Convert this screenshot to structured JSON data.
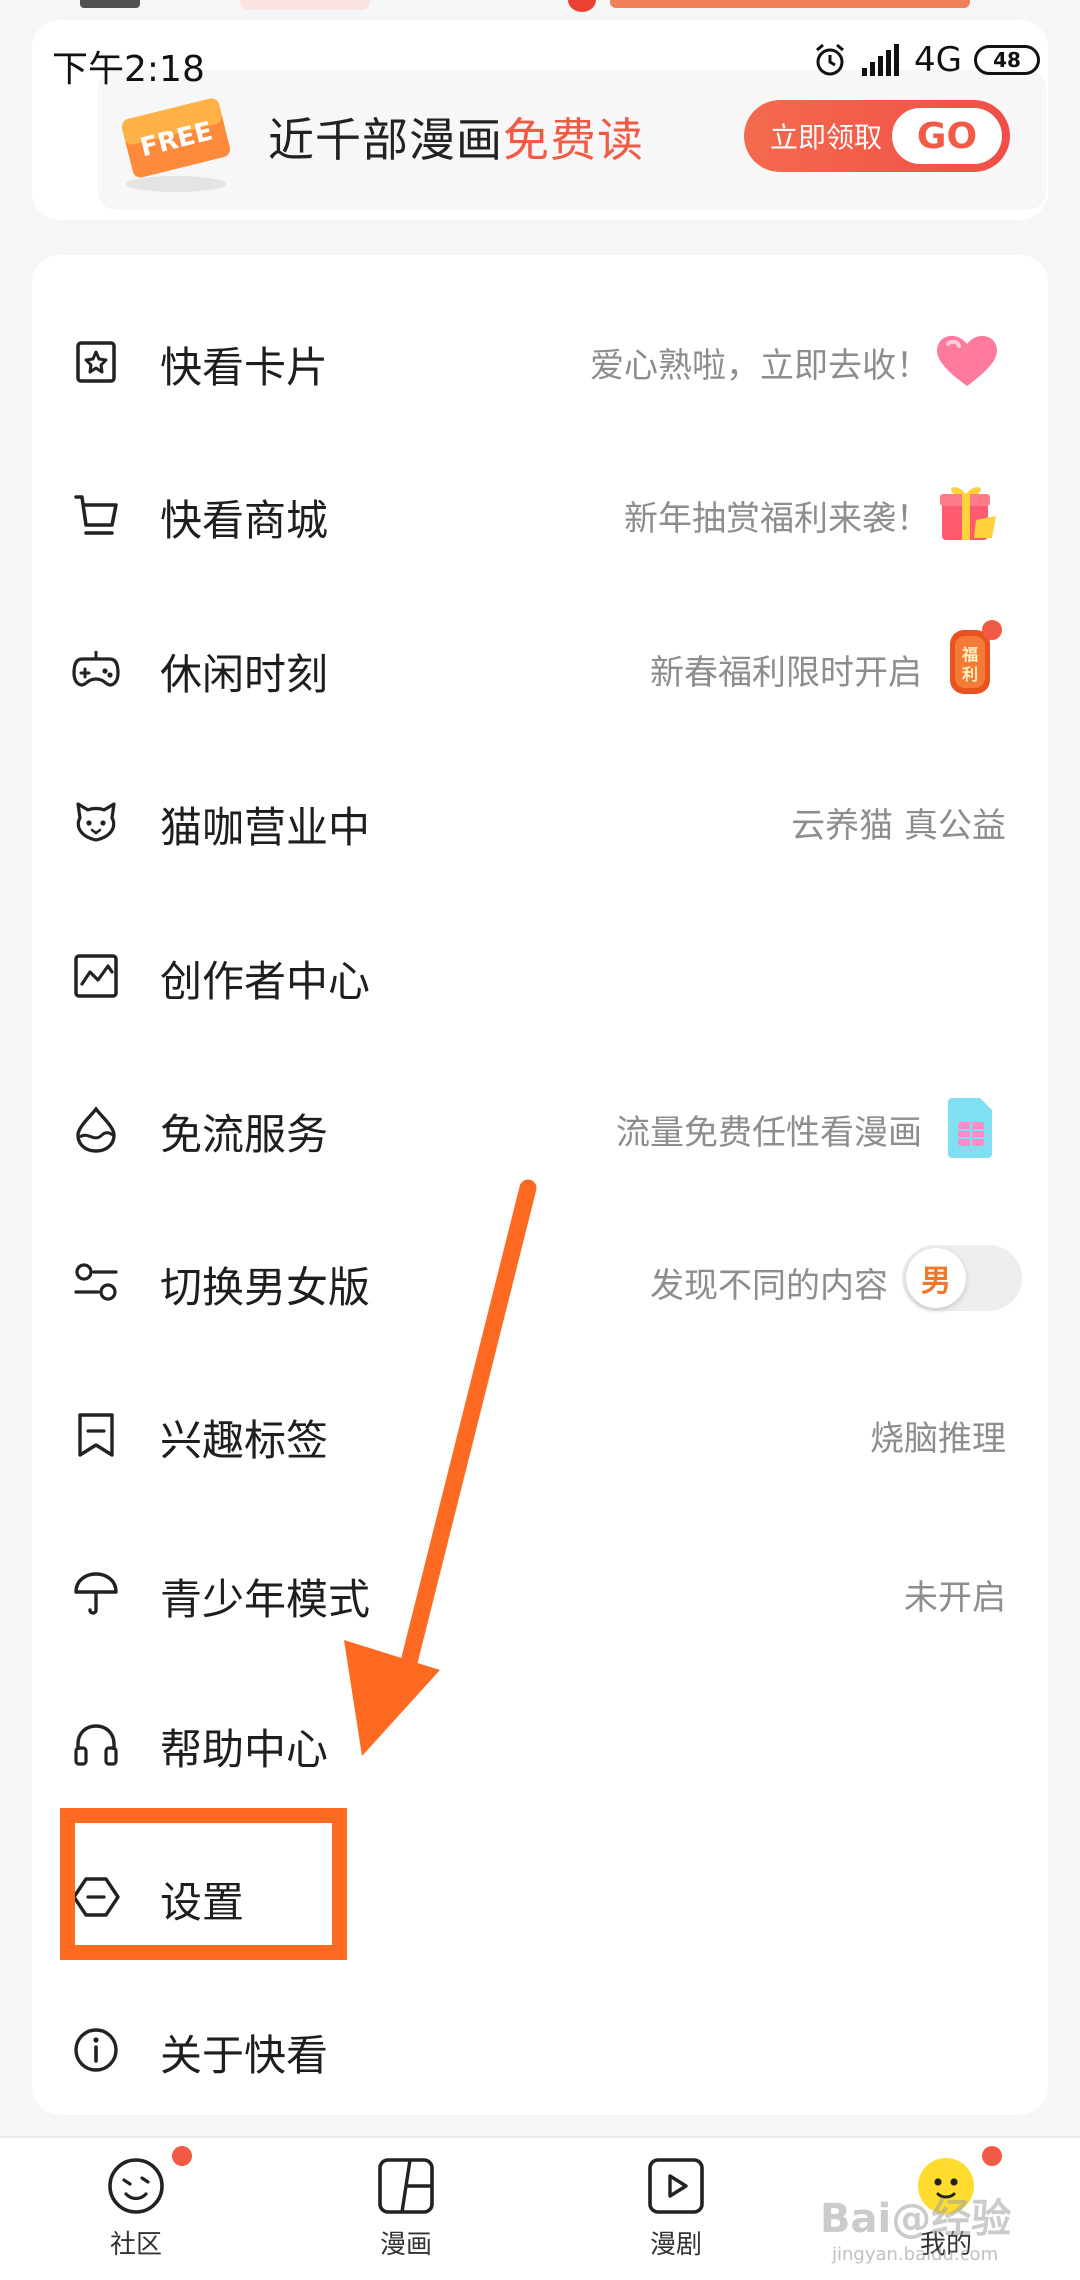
{
  "status_bar": {
    "time": "下午2:18",
    "network": "4G",
    "battery": "48"
  },
  "promo": {
    "badge": "FREE",
    "text_prefix": "近千部漫画",
    "text_highlight": "免费读",
    "claim_label": "立即领取",
    "go_label": "GO"
  },
  "menu": {
    "items": [
      {
        "label": "快看卡片",
        "hint": "爱心熟啦，立即去收！",
        "icon": "card-star-icon"
      },
      {
        "label": "快看商城",
        "hint": "新年抽赏福利来袭！",
        "icon": "cart-icon"
      },
      {
        "label": "休闲时刻",
        "hint": "新春福利限时开启",
        "icon": "gamepad-icon"
      },
      {
        "label": "猫咖营业中",
        "hint": "云养猫 真公益",
        "icon": "cat-icon"
      },
      {
        "label": "创作者中心",
        "hint": "",
        "icon": "chart-icon"
      },
      {
        "label": "免流服务",
        "hint": "流量免费任性看漫画",
        "icon": "drop-icon"
      },
      {
        "label": "切换男女版",
        "hint": "发现不同的内容",
        "icon": "switch-icon"
      },
      {
        "label": "兴趣标签",
        "hint": "烧脑推理",
        "icon": "tag-icon"
      },
      {
        "label": "青少年模式",
        "hint": "未开启",
        "icon": "umbrella-icon"
      },
      {
        "label": "帮助中心",
        "hint": "",
        "icon": "headphones-icon"
      },
      {
        "label": "设置",
        "hint": "",
        "icon": "settings-hexagon-icon"
      },
      {
        "label": "关于快看",
        "hint": "",
        "icon": "info-icon"
      }
    ],
    "fuli_badge": "福利",
    "gender_value": "男"
  },
  "bottom_nav": {
    "tabs": [
      {
        "label": "社区",
        "icon": "community-icon"
      },
      {
        "label": "漫画",
        "icon": "comic-icon"
      },
      {
        "label": "漫剧",
        "icon": "play-icon"
      },
      {
        "label": "我的",
        "icon": "profile-icon"
      }
    ]
  },
  "watermark": {
    "main": "Bai@经验",
    "sub": "jingyan.baidu.com"
  },
  "colors": {
    "accent": "#f25a45",
    "annotation": "#ff6a22"
  }
}
